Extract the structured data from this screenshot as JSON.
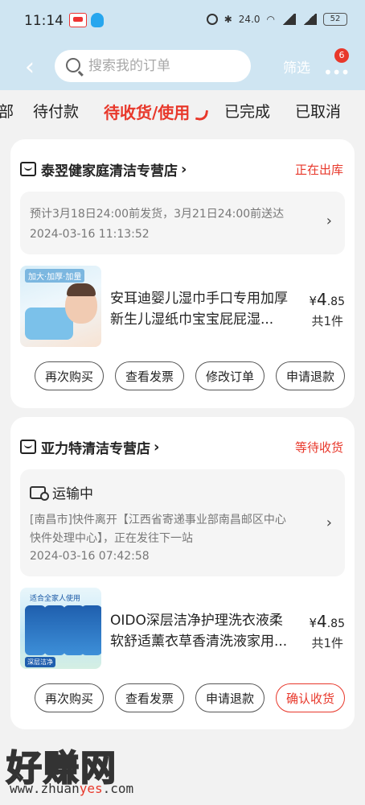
{
  "status_bar": {
    "time": "11:14",
    "net_speed": "24.0",
    "battery": "52"
  },
  "header": {
    "search_placeholder": "搜索我的订单",
    "filter_label": "筛选",
    "more_badge": "6"
  },
  "tabs": [
    {
      "label": "部",
      "active": false
    },
    {
      "label": "待付款",
      "active": false
    },
    {
      "label": "待收货/使用",
      "active": true
    },
    {
      "label": "已完成",
      "active": false
    },
    {
      "label": "已取消",
      "active": false
    }
  ],
  "orders": [
    {
      "shop_name": "泰翌健家庭清洁专营店",
      "status": "正在出库",
      "info": {
        "line1": "预计3月18日24:00前发货，3月21日24:00前送达",
        "time": "2024-03-16 11:13:52"
      },
      "product": {
        "image_tag": "加大·加厚·加量",
        "name": "安耳迪婴儿湿巾手口专用加厚新生儿湿纸巾宝宝屁屁湿...",
        "price_symbol": "¥",
        "price_int": "4",
        "price_dec": ".85",
        "qty": "共1件"
      },
      "buttons": [
        "再次购买",
        "查看发票",
        "修改订单",
        "申请退款"
      ]
    },
    {
      "shop_name": "亚力特清洁专营店",
      "status": "等待收货",
      "info": {
        "title": "运输中",
        "line1": "[南昌市]快件离开【江西省寄递事业部南昌邮区中心",
        "line2": "快件处理中心】，正在发往下一站",
        "time": "2024-03-16 07:42:58"
      },
      "product": {
        "image_tag": "适合全家人使用",
        "image_foot": "深层洁净",
        "name": "OIDO深层洁净护理洗衣液柔软舒适薰衣草香清洗液家用...",
        "price_symbol": "¥",
        "price_int": "4",
        "price_dec": ".85",
        "qty": "共1件"
      },
      "buttons": [
        "再次购买",
        "查看发票",
        "申请退款",
        "确认收货"
      ]
    }
  ],
  "watermark": {
    "big": "好赚网",
    "small_a": "www.zhuan",
    "small_b": "yes",
    "small_c": ".com"
  },
  "colors": {
    "accent": "#e8382b",
    "header_bg": "#cfe5f2",
    "page_bg": "#f2f2f2"
  }
}
